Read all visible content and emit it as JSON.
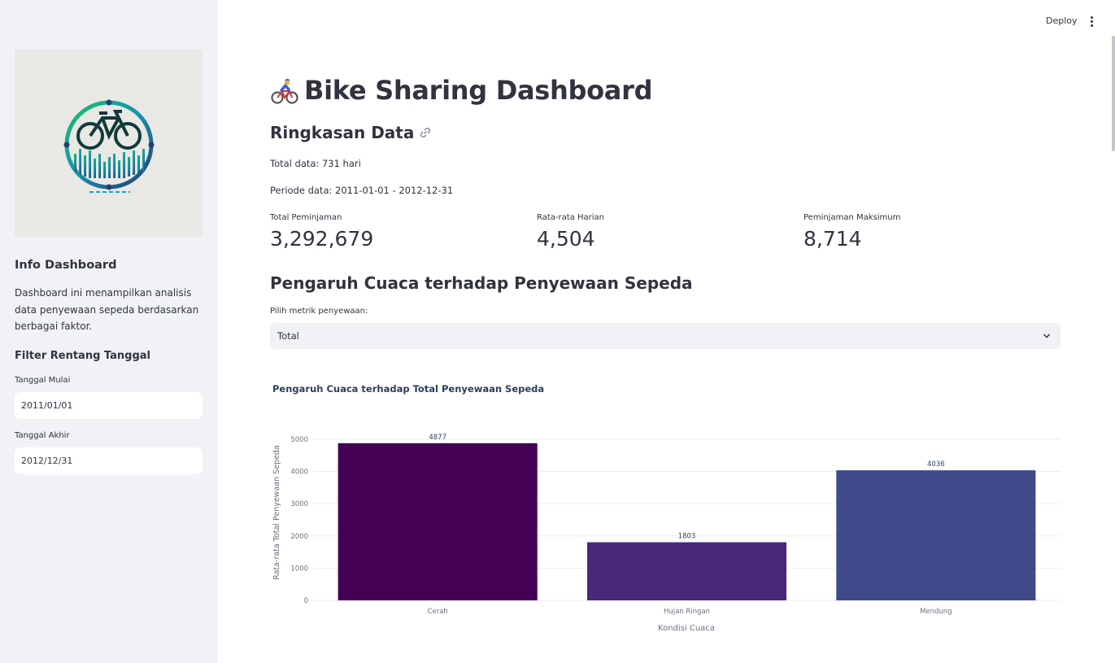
{
  "header": {
    "deploy_label": "Deploy",
    "menu_icon": "more-vertical-icon"
  },
  "sidebar": {
    "logo_alt": "bike-sharing-logo",
    "info_title": "Info Dashboard",
    "info_text": "Dashboard ini menampilkan analisis data penyewaan sepeda berdasarkan berbagai faktor.",
    "filter_title": "Filter Rentang Tanggal",
    "start_label": "Tanggal Mulai",
    "start_value": "2011/01/01",
    "end_label": "Tanggal Akhir",
    "end_value": "2012/12/31"
  },
  "main": {
    "title": "Bike Sharing Dashboard",
    "summary_title": "Ringkasan Data",
    "total_data": "Total data: 731 hari",
    "period": "Periode data: 2011-01-01 - 2012-12-31",
    "metrics": [
      {
        "label": "Total Peminjaman",
        "value": "3,292,679"
      },
      {
        "label": "Rata-rata Harian",
        "value": "4,504"
      },
      {
        "label": "Peminjaman Maksimum",
        "value": "8,714"
      }
    ],
    "weather_title": "Pengaruh Cuaca terhadap Penyewaan Sepeda",
    "select_label": "Pilih metrik penyewaan:",
    "select_value": "Total"
  },
  "colors": {
    "bar_cerah": "#440154",
    "bar_hujan": "#482878",
    "bar_mendung": "#3e4a89",
    "accent": "#ff4b4b"
  },
  "chart_data": {
    "type": "bar",
    "title": "Pengaruh Cuaca terhadap Total Penyewaan Sepeda",
    "xlabel": "Kondisi Cuaca",
    "ylabel": "Rata-rata Total Penyewaan Sepeda",
    "categories": [
      "Cerah",
      "Hujan Ringan",
      "Mendung"
    ],
    "values": [
      4877,
      1803,
      4036
    ],
    "data_labels": [
      "4877",
      "1803",
      "4036"
    ],
    "yticks": [
      0,
      1000,
      2000,
      3000,
      4000,
      5000
    ],
    "ylim": [
      0,
      5200
    ],
    "grid": true,
    "colors": [
      "#440154",
      "#482878",
      "#3e4a89"
    ]
  }
}
